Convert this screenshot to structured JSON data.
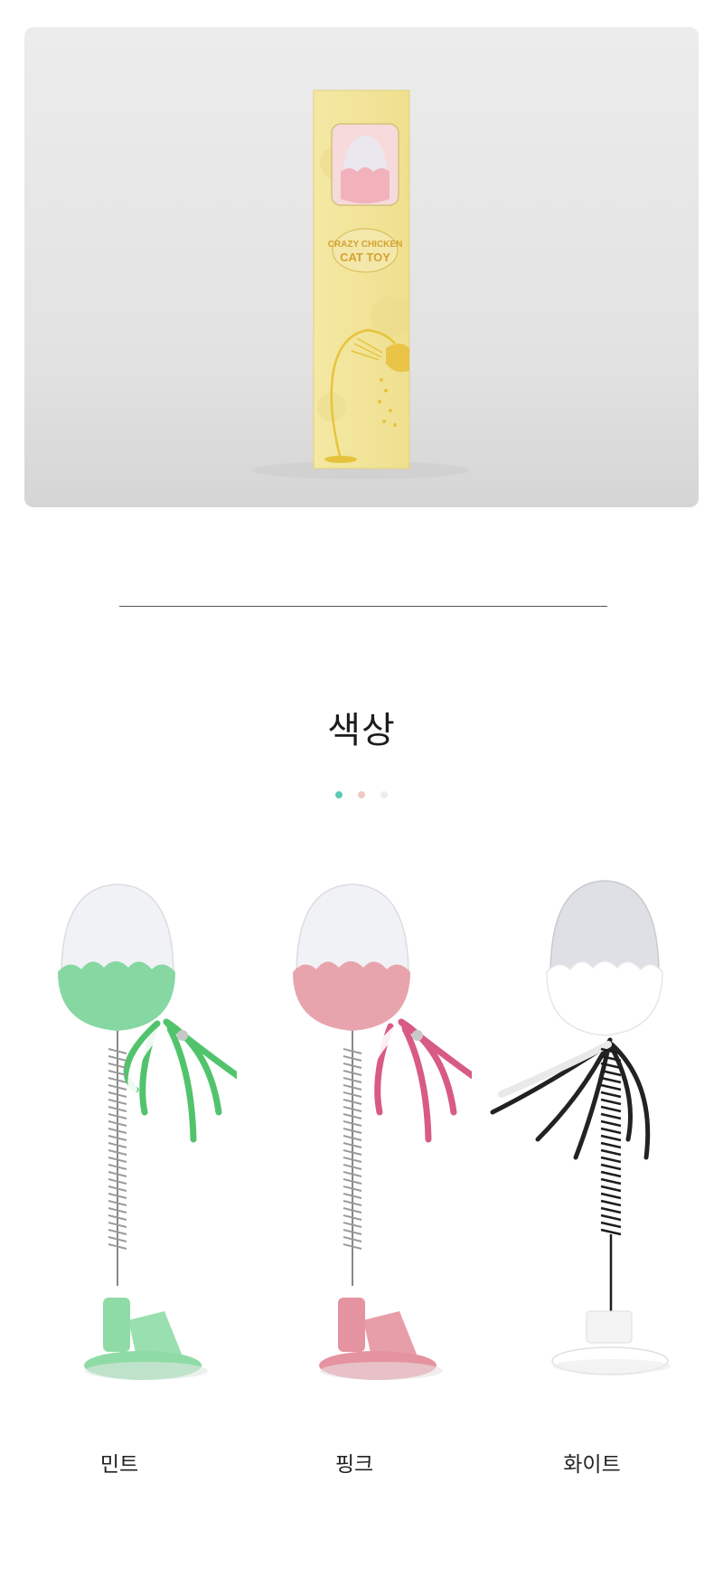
{
  "hero": {
    "box_text_line1": "CRAZY CHICKEN",
    "box_text_line2": "CAT TOY"
  },
  "section": {
    "title": "색상"
  },
  "dots": [
    "#5cc9b4",
    "#f0c9c4",
    "#ececec"
  ],
  "colors": [
    {
      "label": "민트",
      "shell": "#86d7a2",
      "feather": "#52c36d",
      "base": "#8fdba6"
    },
    {
      "label": "핑크",
      "shell": "#e8a4ad",
      "feather": "#d85a86",
      "base": "#e593a0"
    },
    {
      "label": "화이트",
      "shell": "#ffffff",
      "feather": "#222222",
      "base": "#ffffff"
    }
  ]
}
